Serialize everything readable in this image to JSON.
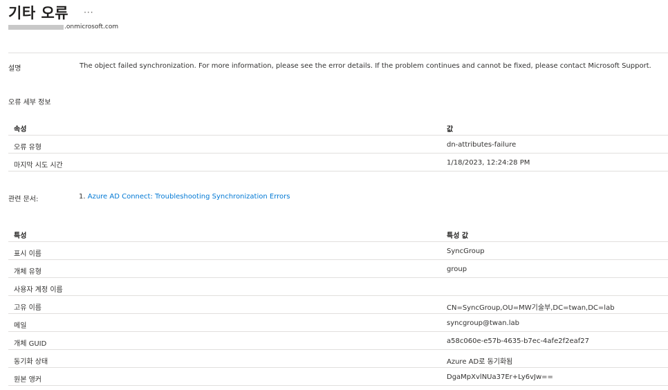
{
  "header": {
    "title": "기타 오류",
    "more_label": "···",
    "tenant_suffix": ".onmicrosoft.com"
  },
  "description": {
    "label": "설명",
    "text": "The object failed synchronization. For more information, please see the error details. If the problem continues and cannot be fixed, please contact Microsoft Support."
  },
  "error_details": {
    "section_label": "오류 세부 정보",
    "columns": [
      "속성",
      "값"
    ],
    "rows": [
      [
        "오류 유형",
        "dn-attributes-failure"
      ],
      [
        "마지막 시도 시간",
        "1/18/2023, 12:24:28 PM"
      ]
    ]
  },
  "related": {
    "label": "관련 문서:",
    "link_number": "1.",
    "link_text": "Azure AD Connect: Troubleshooting Synchronization Errors"
  },
  "attributes": {
    "columns": [
      "특성",
      "특성 값"
    ],
    "rows": [
      [
        "표시 이름",
        "SyncGroup"
      ],
      [
        "개체 유형",
        "group"
      ],
      [
        "사용자 계정 이름",
        ""
      ],
      [
        "고유 이름",
        "CN=SyncGroup,OU=MW기술부,DC=twan,DC=lab"
      ],
      [
        "메일",
        "syncgroup@twan.lab"
      ],
      [
        "개체 GUID",
        "a58c060e-e57b-4635-b7ec-4afe2f2eaf27"
      ],
      [
        "동기화 상태",
        "Azure AD로 동기화됨"
      ],
      [
        "원본 앵커",
        "DgaMpXvlNUa37Er+Ly6vJw=="
      ]
    ]
  },
  "colors": {
    "link": "#0078d4",
    "divider": "#e1dfdd",
    "text": "#323130"
  }
}
